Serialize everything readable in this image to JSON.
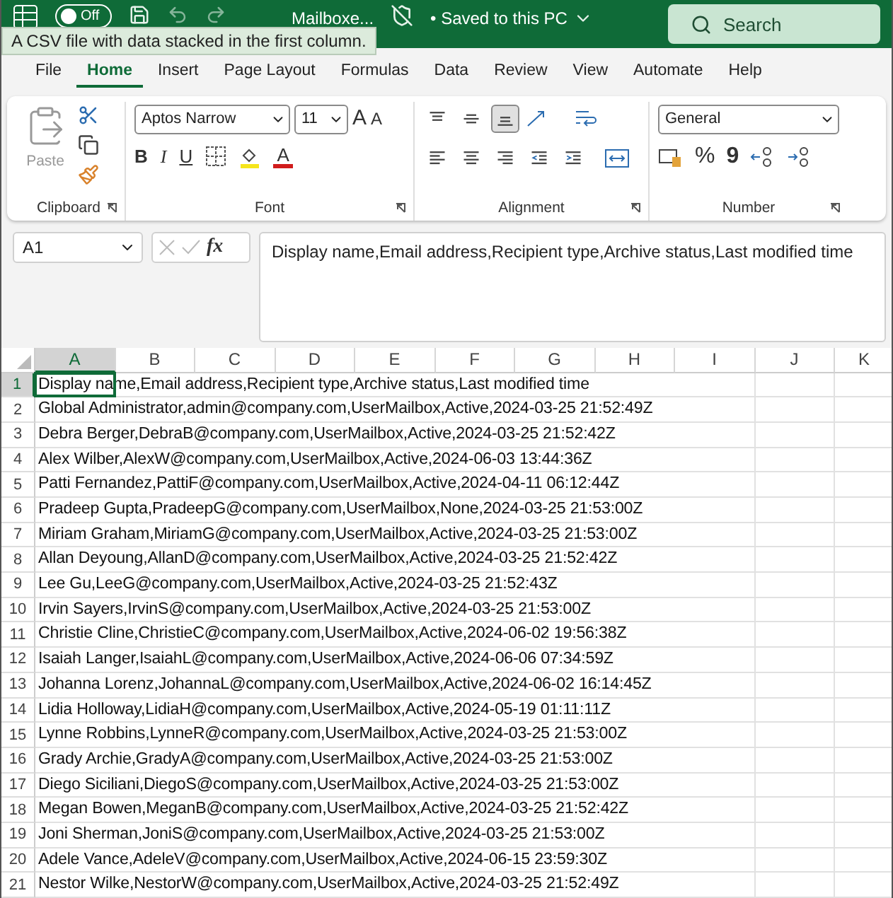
{
  "title_bar": {
    "autosave": {
      "label": "Off",
      "on": false
    },
    "file_name": "Mailboxe...",
    "save_status": "• Saved to this PC",
    "search": {
      "placeholder": "Search"
    }
  },
  "tooltip": "A CSV file with data stacked in the first column.",
  "menu_tabs": [
    {
      "label": "File",
      "selected": false
    },
    {
      "label": "Home",
      "selected": true
    },
    {
      "label": "Insert",
      "selected": false
    },
    {
      "label": "Page Layout",
      "selected": false
    },
    {
      "label": "Formulas",
      "selected": false
    },
    {
      "label": "Data",
      "selected": false
    },
    {
      "label": "Review",
      "selected": false
    },
    {
      "label": "View",
      "selected": false
    },
    {
      "label": "Automate",
      "selected": false
    },
    {
      "label": "Help",
      "selected": false
    }
  ],
  "ribbon": {
    "clipboard": {
      "label": "Clipboard",
      "paste": "Paste"
    },
    "font": {
      "label": "Font",
      "family": "Aptos Narrow",
      "size": "11",
      "grow": "A",
      "shrink": "A",
      "bold": "B",
      "italic": "I",
      "underline": "U",
      "font_color": "A"
    },
    "alignment": {
      "label": "Alignment",
      "vertical": [
        {
          "kind": "top",
          "selected": false
        },
        {
          "kind": "middle",
          "selected": false
        },
        {
          "kind": "bottom",
          "selected": true
        }
      ],
      "horizontal": [
        {
          "kind": "left",
          "selected": false
        },
        {
          "kind": "center",
          "selected": false
        },
        {
          "kind": "right",
          "selected": false
        },
        {
          "kind": "outdent",
          "selected": false
        },
        {
          "kind": "indent",
          "selected": false
        }
      ]
    },
    "number": {
      "label": "Number",
      "format": "General",
      "percent": "%",
      "comma": "9"
    }
  },
  "formula_bar": {
    "name_box": "A1",
    "function_label": "fx",
    "formula": "Display name,Email address,Recipient type,Archive status,Last modified time"
  },
  "sheet": {
    "columns": [
      {
        "label": "A",
        "selected": true
      },
      {
        "label": "B",
        "selected": false
      },
      {
        "label": "C",
        "selected": false
      },
      {
        "label": "D",
        "selected": false
      },
      {
        "label": "E",
        "selected": false
      },
      {
        "label": "F",
        "selected": false
      },
      {
        "label": "G",
        "selected": false
      },
      {
        "label": "H",
        "selected": false
      },
      {
        "label": "I",
        "selected": false
      },
      {
        "label": "J",
        "selected": false
      },
      {
        "label": "K",
        "selected": false
      }
    ],
    "rows": [
      {
        "number": "1",
        "text": "Display name,Email address,Recipient type,Archive status,Last modified time",
        "selected": true
      },
      {
        "number": "2",
        "text": "Global Administrator,admin@company.com,UserMailbox,Active,2024-03-25 21:52:49Z",
        "selected": false
      },
      {
        "number": "3",
        "text": "Debra Berger,DebraB@company.com,UserMailbox,Active,2024-03-25 21:52:42Z",
        "selected": false
      },
      {
        "number": "4",
        "text": "Alex Wilber,AlexW@company.com,UserMailbox,Active,2024-06-03 13:44:36Z",
        "selected": false
      },
      {
        "number": "5",
        "text": "Patti Fernandez,PattiF@company.com,UserMailbox,Active,2024-04-11 06:12:44Z",
        "selected": false
      },
      {
        "number": "6",
        "text": "Pradeep Gupta,PradeepG@company.com,UserMailbox,None,2024-03-25 21:53:00Z",
        "selected": false
      },
      {
        "number": "7",
        "text": "Miriam Graham,MiriamG@company.com,UserMailbox,Active,2024-03-25 21:53:00Z",
        "selected": false
      },
      {
        "number": "8",
        "text": "Allan Deyoung,AllanD@company.com,UserMailbox,Active,2024-03-25 21:52:42Z",
        "selected": false
      },
      {
        "number": "9",
        "text": "Lee Gu,LeeG@company.com,UserMailbox,Active,2024-03-25 21:52:43Z",
        "selected": false
      },
      {
        "number": "10",
        "text": "Irvin Sayers,IrvinS@company.com,UserMailbox,Active,2024-03-25 21:53:00Z",
        "selected": false
      },
      {
        "number": "11",
        "text": "Christie Cline,ChristieC@company.com,UserMailbox,Active,2024-06-02 19:56:38Z",
        "selected": false
      },
      {
        "number": "12",
        "text": "Isaiah Langer,IsaiahL@company.com,UserMailbox,Active,2024-06-06 07:34:59Z",
        "selected": false
      },
      {
        "number": "13",
        "text": "Johanna Lorenz,JohannaL@company.com,UserMailbox,Active,2024-06-02 16:14:45Z",
        "selected": false
      },
      {
        "number": "14",
        "text": "Lidia Holloway,LidiaH@company.com,UserMailbox,Active,2024-05-19 01:11:11Z",
        "selected": false
      },
      {
        "number": "15",
        "text": "Lynne Robbins,LynneR@company.com,UserMailbox,Active,2024-03-25 21:53:00Z",
        "selected": false
      },
      {
        "number": "16",
        "text": "Grady Archie,GradyA@company.com,UserMailbox,Active,2024-03-25 21:53:00Z",
        "selected": false
      },
      {
        "number": "17",
        "text": "Diego Siciliani,DiegoS@company.com,UserMailbox,Active,2024-03-25 21:53:00Z",
        "selected": false
      },
      {
        "number": "18",
        "text": "Megan Bowen,MeganB@company.com,UserMailbox,Active,2024-03-25 21:52:42Z",
        "selected": false
      },
      {
        "number": "19",
        "text": "Joni Sherman,JoniS@company.com,UserMailbox,Active,2024-03-25 21:53:00Z",
        "selected": false
      },
      {
        "number": "20",
        "text": "Adele Vance,AdeleV@company.com,UserMailbox,Active,2024-06-15 23:59:30Z",
        "selected": false
      },
      {
        "number": "21",
        "text": "Nestor Wilke,NestorW@company.com,UserMailbox,Active,2024-03-25 21:52:49Z",
        "selected": false
      }
    ]
  }
}
